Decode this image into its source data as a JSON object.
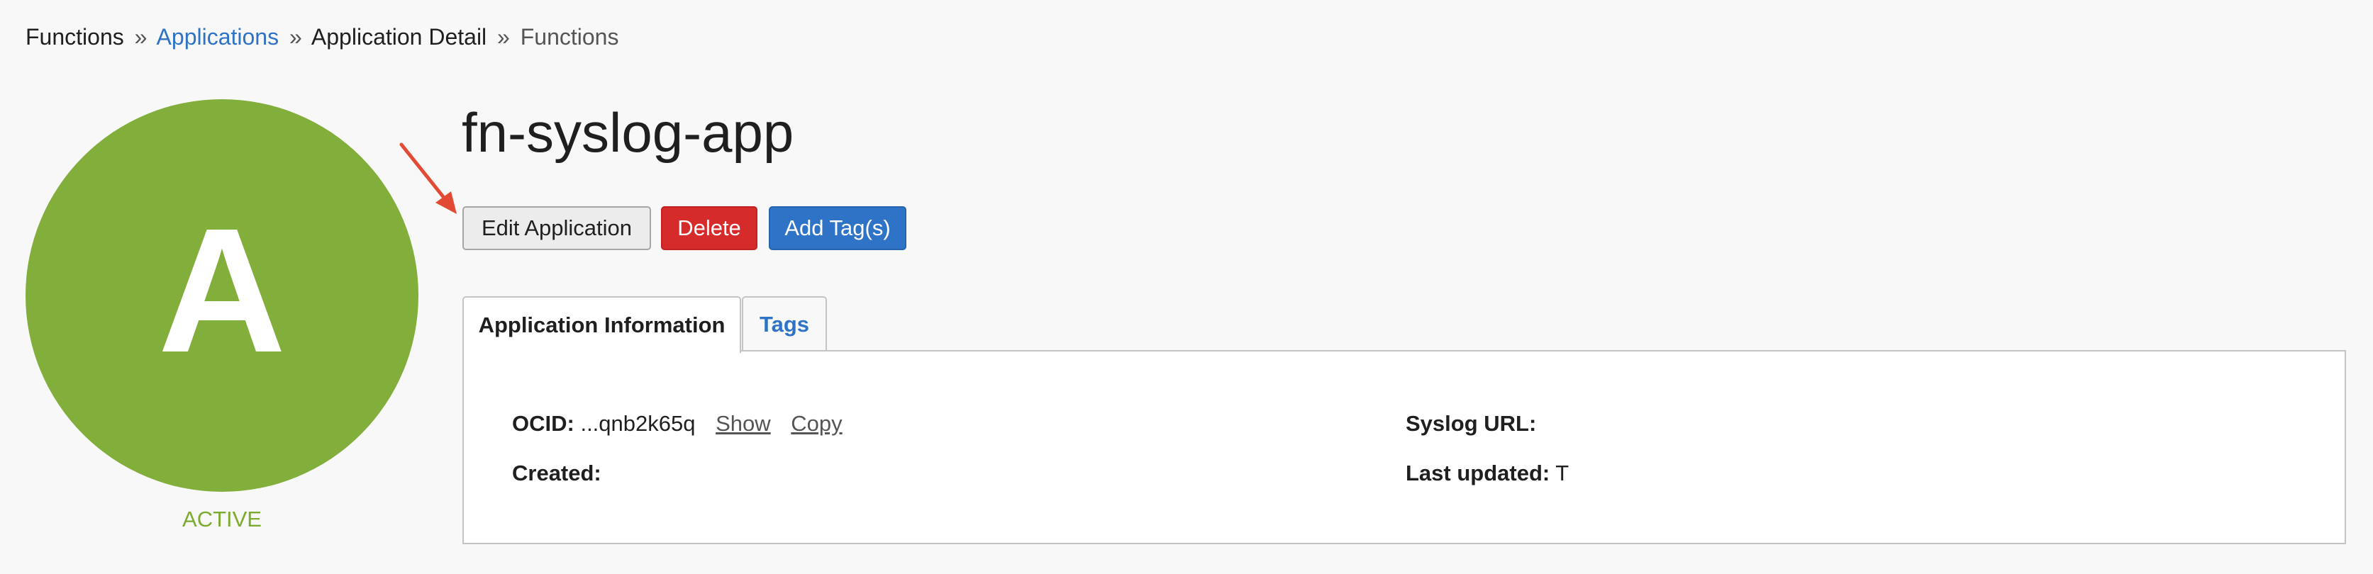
{
  "breadcrumb": {
    "functions": "Functions",
    "separator": "»",
    "applications": "Applications",
    "application_detail": "Application Detail",
    "current": "Functions"
  },
  "avatar": {
    "letter": "A",
    "status": "ACTIVE"
  },
  "app": {
    "title": "fn-syslog-app"
  },
  "buttons": {
    "edit": "Edit Application",
    "delete": "Delete",
    "add_tags": "Add Tag(s)"
  },
  "tabs": {
    "info": "Application Information",
    "tags": "Tags"
  },
  "details": {
    "ocid_label": "OCID:",
    "ocid_value": "...qnb2k65q",
    "show": "Show",
    "copy": "Copy",
    "created_label": "Created:",
    "created_value": "",
    "syslog_label": "Syslog URL:",
    "syslog_value": "",
    "updated_label": "Last updated:",
    "updated_value": "T"
  },
  "colors": {
    "avatar": "#82ae3b",
    "status": "#7cab2f",
    "link": "#2e73c6",
    "delete": "#d62b2b",
    "primary": "#2e73c6",
    "arrow": "#e24a33"
  },
  "icons": {
    "annotation_arrow": "red-arrow-icon"
  }
}
